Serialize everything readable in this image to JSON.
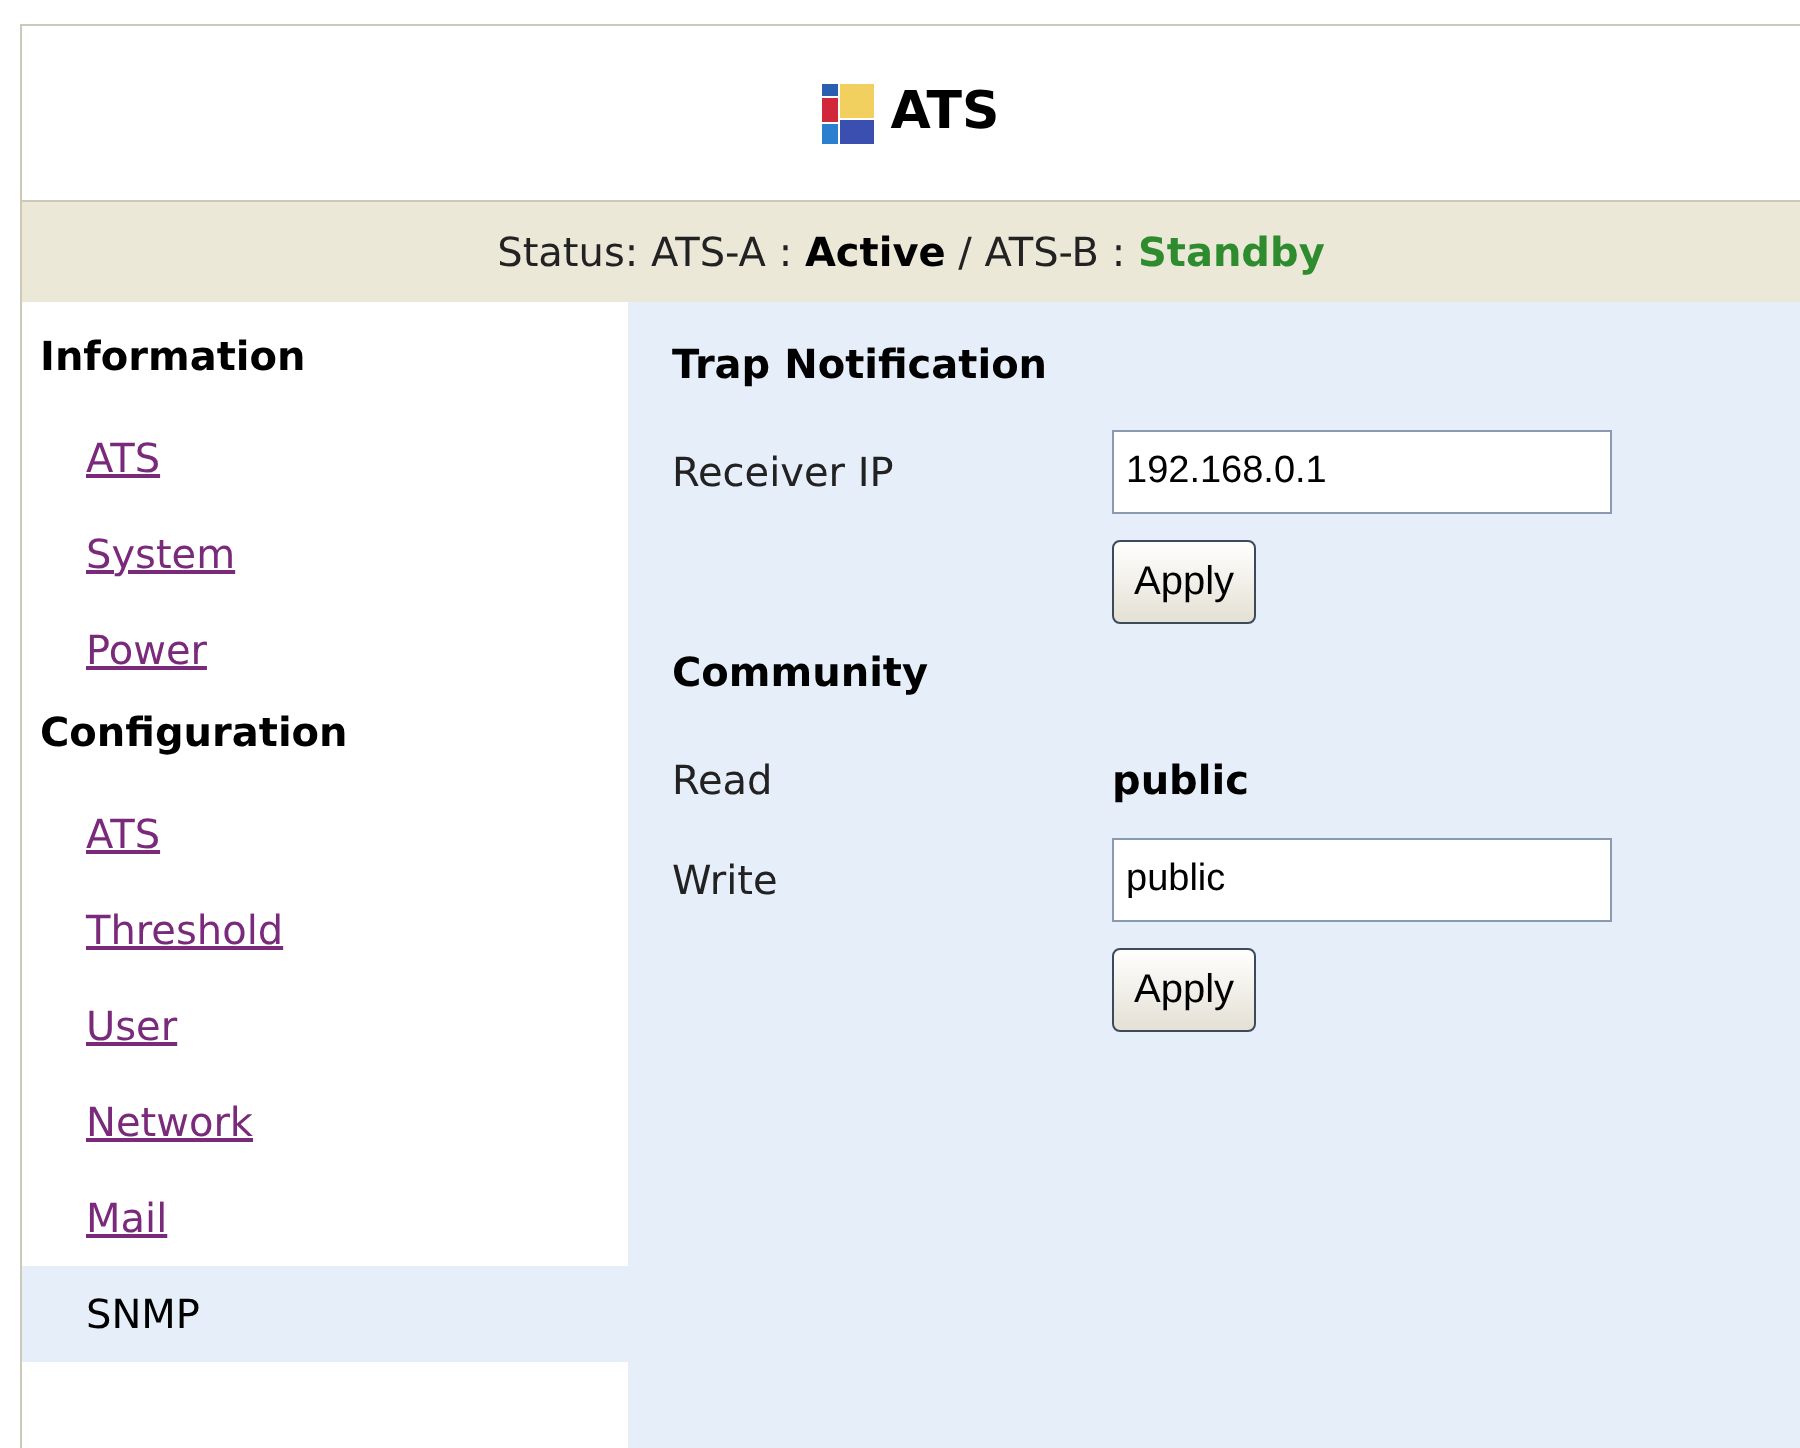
{
  "header": {
    "title": "ATS"
  },
  "status": {
    "label": "Status:",
    "units": [
      {
        "name": "ATS-A",
        "state": "Active",
        "kind": "active"
      },
      {
        "name": "ATS-B",
        "state": "Standby",
        "kind": "standby"
      }
    ],
    "separator": "/",
    "colon": ":"
  },
  "sidebar": {
    "groups": [
      {
        "heading": "Information",
        "items": [
          {
            "label": "ATS",
            "selected": false
          },
          {
            "label": "System",
            "selected": false
          },
          {
            "label": "Power",
            "selected": false
          }
        ]
      },
      {
        "heading": "Configuration",
        "items": [
          {
            "label": "ATS",
            "selected": false
          },
          {
            "label": "Threshold",
            "selected": false
          },
          {
            "label": "User",
            "selected": false
          },
          {
            "label": "Network",
            "selected": false
          },
          {
            "label": "Mail",
            "selected": false
          },
          {
            "label": "SNMP",
            "selected": true
          }
        ]
      }
    ]
  },
  "sections": [
    {
      "title": "Trap Notification",
      "rows": [
        {
          "kind": "input",
          "label": "Receiver IP",
          "value": "192.168.0.1"
        },
        {
          "kind": "button",
          "label": "Apply"
        }
      ]
    },
    {
      "title": "Community",
      "rows": [
        {
          "kind": "static",
          "label": "Read",
          "value": "public"
        },
        {
          "kind": "input",
          "label": "Write",
          "value": "public"
        },
        {
          "kind": "button",
          "label": "Apply"
        }
      ]
    }
  ]
}
